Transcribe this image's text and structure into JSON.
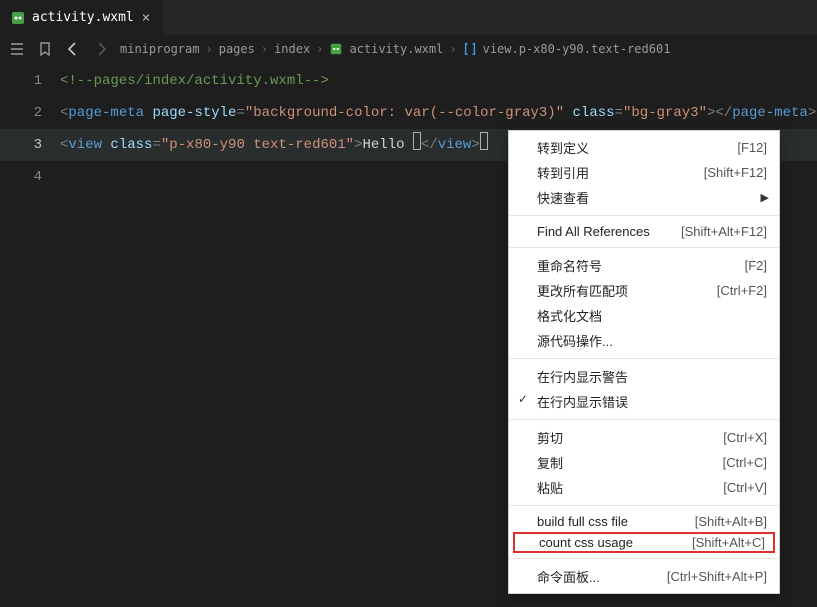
{
  "tab": {
    "filename": "activity.wxml",
    "modified": false
  },
  "breadcrumbs": {
    "crumb1": "miniprogram",
    "crumb2": "pages",
    "crumb3": "index",
    "crumb4": "activity.wxml",
    "crumb5": "view.p-x80-y90.text-red601"
  },
  "code": {
    "l1": {
      "no": "1",
      "comment": "<!--pages/index/activity.wxml-->"
    },
    "l2": {
      "no": "2",
      "t_open": "<",
      "tag": "page-meta",
      "sp1": " ",
      "attr1": "page-style",
      "eq1": "=",
      "val1": "\"background-color: var(--color-gray3)\"",
      "sp2": " ",
      "attr2": "class",
      "eq2": "=",
      "val2": "\"bg-gray3\"",
      "close1": ">",
      "t_close": "</",
      "tag_close": "page-meta",
      "close2": ">"
    },
    "l3": {
      "no": "3",
      "t_open": "<",
      "tag": "view",
      "sp1": " ",
      "attr1": "class",
      "eq1": "=",
      "val1": "\"p-x80-y90 text-red601\"",
      "close1": ">",
      "text": "Hello ",
      "t_close": "</",
      "tag_close": "view",
      "close2": ">"
    },
    "l4": {
      "no": "4"
    }
  },
  "menu": {
    "goto_def": "转到定义",
    "goto_def_sc": "[F12]",
    "goto_ref": "转到引用",
    "goto_ref_sc": "[Shift+F12]",
    "quick_look": "快速查看",
    "find_all": "Find All References",
    "find_all_sc": "[Shift+Alt+F12]",
    "rename": "重命名符号",
    "rename_sc": "[F2]",
    "change_all": "更改所有匹配项",
    "change_all_sc": "[Ctrl+F2]",
    "format_doc": "格式化文档",
    "src_ops": "源代码操作...",
    "inline_warn": "在行内显示警告",
    "inline_err": "在行内显示错误",
    "cut": "剪切",
    "cut_sc": "[Ctrl+X]",
    "copy": "复制",
    "copy_sc": "[Ctrl+C]",
    "paste": "粘贴",
    "paste_sc": "[Ctrl+V]",
    "build_css": "build full css file",
    "build_css_sc": "[Shift+Alt+B]",
    "count_css": "count css usage",
    "count_css_sc": "[Shift+Alt+C]",
    "cmd_palette": "命令面板...",
    "cmd_palette_sc": "[Ctrl+Shift+Alt+P]"
  }
}
